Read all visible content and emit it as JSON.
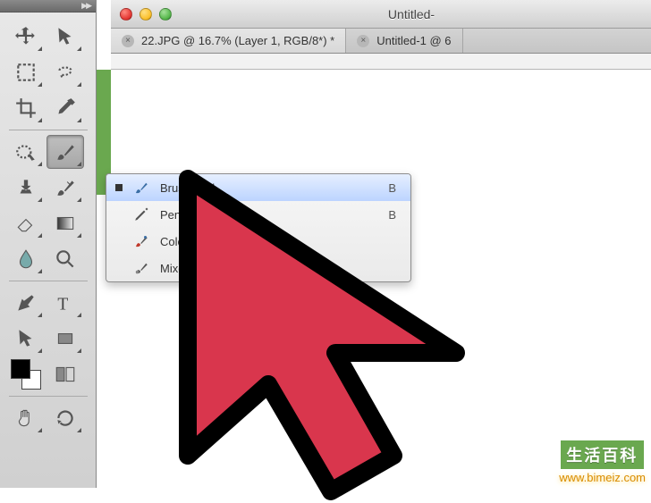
{
  "toolbox": {
    "tools": [
      {
        "name": "move-tool"
      },
      {
        "name": "selection-arrow-tool"
      },
      {
        "name": "marquee-tool"
      },
      {
        "name": "lasso-tool"
      },
      {
        "name": "crop-tool"
      },
      {
        "name": "eyedropper-tool"
      },
      {
        "name": "quick-select-tool"
      },
      {
        "name": "brush-tool",
        "active": true
      },
      {
        "name": "clone-stamp-tool"
      },
      {
        "name": "history-brush-tool"
      },
      {
        "name": "eraser-tool"
      },
      {
        "name": "gradient-tool"
      },
      {
        "name": "blur-tool"
      },
      {
        "name": "zoom-tool"
      },
      {
        "name": "pen-tool"
      },
      {
        "name": "type-tool"
      },
      {
        "name": "path-select-tool"
      },
      {
        "name": "rectangle-shape-tool"
      },
      {
        "name": "hand-tool"
      },
      {
        "name": "rotate-view-tool"
      }
    ]
  },
  "window": {
    "title": "Untitled-",
    "tabs": [
      {
        "label": "22.JPG @ 16.7% (Layer 1, RGB/8*) *",
        "active": true
      },
      {
        "label": "Untitled-1 @ 6",
        "active": false
      }
    ]
  },
  "flyout": {
    "items": [
      {
        "label": "Brush Tool",
        "shortcut": "B",
        "icon": "brush-icon",
        "selected": true
      },
      {
        "label": "Pencil",
        "shortcut": "B",
        "icon": "pencil-icon",
        "selected": false
      },
      {
        "label": "Color Rep",
        "shortcut": "",
        "icon": "color-replace-icon",
        "selected": false
      },
      {
        "label": "Mixer Brush",
        "shortcut": "",
        "icon": "mixer-brush-icon",
        "selected": false
      }
    ]
  },
  "watermark": {
    "badge": "生活百科",
    "url": "www.bimeiz.com"
  }
}
